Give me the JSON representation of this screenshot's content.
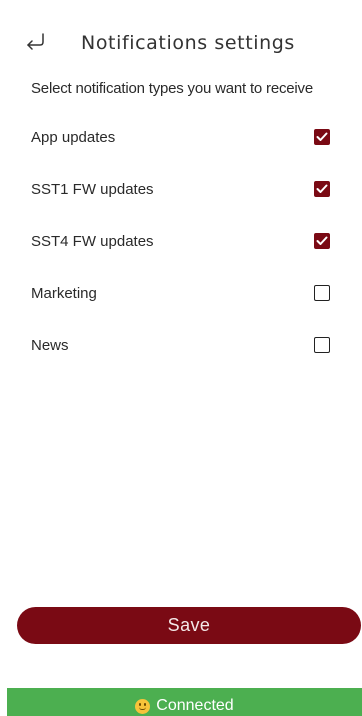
{
  "header": {
    "back_icon": "return-arrow-icon",
    "title": "Notifications settings"
  },
  "subtitle": "Select notification types you want to receive",
  "options": [
    {
      "label": "App updates",
      "checked": true
    },
    {
      "label": "SST1 FW updates",
      "checked": true
    },
    {
      "label": "SST4 FW updates",
      "checked": true
    },
    {
      "label": "Marketing",
      "checked": false
    },
    {
      "label": "News",
      "checked": false
    }
  ],
  "save_label": "Save",
  "status": {
    "icon": "smiley-face-icon",
    "label": "Connected"
  },
  "colors": {
    "accent": "#7a0a14",
    "status_bg": "#4caf50"
  }
}
